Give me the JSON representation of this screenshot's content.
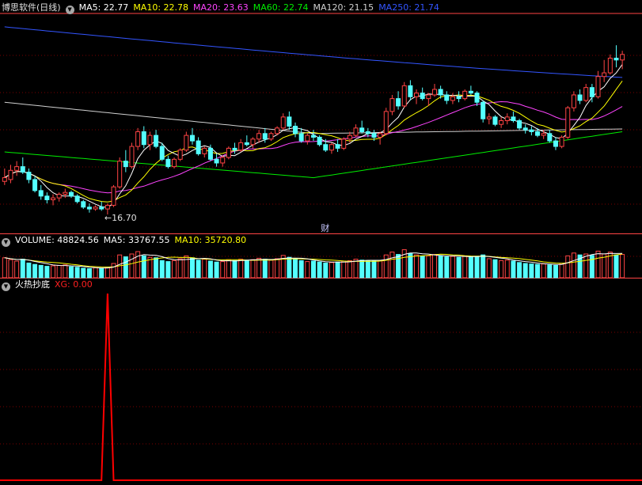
{
  "window": {
    "title": "博思软件(日线)"
  },
  "icons": {
    "dropdown": "chevron-down-icon"
  },
  "colors": {
    "background": "#000000",
    "up": "#ff4444",
    "down": "#54ffff",
    "grid": "#7a0000",
    "ma5": "#ffffff",
    "ma10": "#ffff00",
    "ma20": "#ff44ff",
    "ma60": "#00ee00",
    "ma120": "#d0d0d0",
    "ma250": "#3355ff",
    "indicator": "#ff0000"
  },
  "price_header": {
    "ma5": "MA5: 22.77",
    "ma10": "MA10: 22.78",
    "ma20": "MA20: 23.63",
    "ma60": "MA60: 22.74",
    "ma120": "MA120: 21.15",
    "ma250": "MA250: 21.74"
  },
  "volume_header": {
    "volume": "VOLUME: 48824.56",
    "ma5": "MA5: 33767.55",
    "ma10": "MA10: 35720.80"
  },
  "indicator_header": {
    "name": "火热抄底",
    "xg": "XG: 0.00"
  },
  "annotations": {
    "low_label": "←16.70",
    "finance_marker": "财"
  },
  "chart_data": [
    {
      "type": "candlestick",
      "panel": "price",
      "low_marker": 16.7,
      "ylim": [
        15.8,
        27.5
      ],
      "candles": [
        [
          18.5,
          19.2,
          18.3,
          18.7
        ],
        [
          18.6,
          19.4,
          18.4,
          19.1
        ],
        [
          19.1,
          19.6,
          18.8,
          19.3
        ],
        [
          19.3,
          19.8,
          18.9,
          19.0
        ],
        [
          19.0,
          19.2,
          18.4,
          18.6
        ],
        [
          18.6,
          18.8,
          17.9,
          18.0
        ],
        [
          18.0,
          18.3,
          17.5,
          17.7
        ],
        [
          17.7,
          17.9,
          17.3,
          17.5
        ],
        [
          17.5,
          17.8,
          17.2,
          17.6
        ],
        [
          17.6,
          17.9,
          17.4,
          17.8
        ],
        [
          17.8,
          18.1,
          17.6,
          17.9
        ],
        [
          17.9,
          18.0,
          17.6,
          17.7
        ],
        [
          17.7,
          17.8,
          17.3,
          17.4
        ],
        [
          17.4,
          17.5,
          17.0,
          17.1
        ],
        [
          17.1,
          17.3,
          16.8,
          17.0
        ],
        [
          17.0,
          17.2,
          16.9,
          17.1
        ],
        [
          17.1,
          17.4,
          16.9,
          17.0
        ],
        [
          17.0,
          17.3,
          16.7,
          17.2
        ],
        [
          17.2,
          18.3,
          17.1,
          18.2
        ],
        [
          18.2,
          19.8,
          18.1,
          19.6
        ],
        [
          19.6,
          20.2,
          19.0,
          19.3
        ],
        [
          19.3,
          20.6,
          19.2,
          20.4
        ],
        [
          20.4,
          21.4,
          20.2,
          21.2
        ],
        [
          21.2,
          21.5,
          20.3,
          20.5
        ],
        [
          20.5,
          21.2,
          20.2,
          21.0
        ],
        [
          21.0,
          21.3,
          20.3,
          20.4
        ],
        [
          20.4,
          20.6,
          19.6,
          19.7
        ],
        [
          19.7,
          19.9,
          19.2,
          19.3
        ],
        [
          19.3,
          19.8,
          19.2,
          19.7
        ],
        [
          19.7,
          20.3,
          19.6,
          20.2
        ],
        [
          20.2,
          21.2,
          20.1,
          21.0
        ],
        [
          21.0,
          21.4,
          20.5,
          20.7
        ],
        [
          20.7,
          20.9,
          19.9,
          20.0
        ],
        [
          20.0,
          20.4,
          19.8,
          20.3
        ],
        [
          20.3,
          20.5,
          19.6,
          19.7
        ],
        [
          19.7,
          20.0,
          19.3,
          19.5
        ],
        [
          19.5,
          19.9,
          19.3,
          19.8
        ],
        [
          19.8,
          20.4,
          19.7,
          20.3
        ],
        [
          20.3,
          20.6,
          20.0,
          20.2
        ],
        [
          20.2,
          20.8,
          20.1,
          20.6
        ],
        [
          20.6,
          21.0,
          20.4,
          20.5
        ],
        [
          20.5,
          20.9,
          20.3,
          20.8
        ],
        [
          20.8,
          21.3,
          20.6,
          21.1
        ],
        [
          21.1,
          21.4,
          20.6,
          20.8
        ],
        [
          20.8,
          21.2,
          20.7,
          21.1
        ],
        [
          21.1,
          21.5,
          21.0,
          21.4
        ],
        [
          21.4,
          22.2,
          21.3,
          22.0
        ],
        [
          22.0,
          22.3,
          21.3,
          21.5
        ],
        [
          21.5,
          21.7,
          20.9,
          21.1
        ],
        [
          21.1,
          21.4,
          20.6,
          20.7
        ],
        [
          20.7,
          21.1,
          20.5,
          21.0
        ],
        [
          21.0,
          21.3,
          20.7,
          20.9
        ],
        [
          20.9,
          21.0,
          20.4,
          20.5
        ],
        [
          20.5,
          20.8,
          20.1,
          20.2
        ],
        [
          20.2,
          20.6,
          20.0,
          20.5
        ],
        [
          20.5,
          20.8,
          20.1,
          20.3
        ],
        [
          20.3,
          20.9,
          20.2,
          20.8
        ],
        [
          20.8,
          21.2,
          20.6,
          21.0
        ],
        [
          21.0,
          21.6,
          20.9,
          21.4
        ],
        [
          21.4,
          21.8,
          21.1,
          21.2
        ],
        [
          21.2,
          21.4,
          20.9,
          21.1
        ],
        [
          21.1,
          21.3,
          20.7,
          20.9
        ],
        [
          20.9,
          21.2,
          20.5,
          21.1
        ],
        [
          21.1,
          22.5,
          21.0,
          22.3
        ],
        [
          22.3,
          23.2,
          22.1,
          23.0
        ],
        [
          23.0,
          23.4,
          22.4,
          22.6
        ],
        [
          22.6,
          23.9,
          22.5,
          23.7
        ],
        [
          23.7,
          24.0,
          22.9,
          23.1
        ],
        [
          23.1,
          23.5,
          22.7,
          23.3
        ],
        [
          23.3,
          23.6,
          22.9,
          23.0
        ],
        [
          23.0,
          23.3,
          22.6,
          23.2
        ],
        [
          23.2,
          23.8,
          23.1,
          23.5
        ],
        [
          23.5,
          23.7,
          23.0,
          23.2
        ],
        [
          23.2,
          23.4,
          22.7,
          22.9
        ],
        [
          22.9,
          23.3,
          22.7,
          23.1
        ],
        [
          23.1,
          23.4,
          22.8,
          23.0
        ],
        [
          23.0,
          23.5,
          22.9,
          23.4
        ],
        [
          23.4,
          23.7,
          23.2,
          23.3
        ],
        [
          23.3,
          23.4,
          22.6,
          22.8
        ],
        [
          22.8,
          22.9,
          21.7,
          21.9
        ],
        [
          21.9,
          22.2,
          21.6,
          22.0
        ],
        [
          22.0,
          22.1,
          21.5,
          21.6
        ],
        [
          21.6,
          22.0,
          21.4,
          21.8
        ],
        [
          21.8,
          22.2,
          21.6,
          22.0
        ],
        [
          22.0,
          22.3,
          21.7,
          21.8
        ],
        [
          21.8,
          21.9,
          21.3,
          21.4
        ],
        [
          21.4,
          21.6,
          21.1,
          21.3
        ],
        [
          21.3,
          21.5,
          21.0,
          21.2
        ],
        [
          21.2,
          21.4,
          20.9,
          21.0
        ],
        [
          21.0,
          21.3,
          20.8,
          21.1
        ],
        [
          21.1,
          21.3,
          20.6,
          20.7
        ],
        [
          20.7,
          20.9,
          20.2,
          20.4
        ],
        [
          20.4,
          21.0,
          20.3,
          20.9
        ],
        [
          20.9,
          22.6,
          20.8,
          22.5
        ],
        [
          22.5,
          23.4,
          22.3,
          23.2
        ],
        [
          23.2,
          23.5,
          22.7,
          22.9
        ],
        [
          22.9,
          23.8,
          22.8,
          23.6
        ],
        [
          23.6,
          23.8,
          22.8,
          23.1
        ],
        [
          23.1,
          24.5,
          23.0,
          24.2
        ],
        [
          24.2,
          25.1,
          23.9,
          24.4
        ],
        [
          24.4,
          25.4,
          24.3,
          25.2
        ],
        [
          25.2,
          25.9,
          24.7,
          25.1
        ],
        [
          25.1,
          25.6,
          24.6,
          25.4
        ]
      ]
    },
    {
      "type": "bar",
      "panel": "volume",
      "values": [
        4.2,
        3.8,
        3.5,
        3.9,
        3.1,
        2.8,
        2.6,
        2.4,
        2.5,
        2.6,
        2.7,
        2.3,
        2.2,
        2.0,
        1.9,
        2.1,
        2.0,
        2.2,
        3.0,
        4.8,
        4.4,
        5.0,
        5.5,
        4.6,
        4.3,
        4.2,
        3.6,
        3.4,
        3.6,
        4.0,
        4.6,
        4.2,
        3.7,
        3.9,
        3.5,
        3.3,
        3.4,
        3.8,
        3.6,
        3.9,
        3.7,
        3.8,
        4.1,
        3.9,
        3.7,
        4.0,
        4.7,
        4.3,
        3.9,
        3.6,
        3.4,
        3.5,
        3.3,
        3.1,
        3.2,
        3.3,
        3.5,
        3.6,
        3.9,
        3.7,
        3.6,
        3.5,
        3.6,
        4.8,
        5.4,
        4.9,
        5.9,
        5.1,
        4.8,
        4.5,
        4.6,
        4.9,
        4.6,
        4.4,
        4.5,
        4.3,
        4.6,
        4.4,
        4.5,
        4.8,
        4.0,
        3.8,
        3.6,
        3.7,
        3.5,
        3.2,
        3.0,
        2.9,
        2.8,
        2.9,
        2.7,
        2.6,
        3.0,
        4.6,
        5.2,
        4.8,
        5.0,
        4.7,
        5.6,
        5.0,
        5.4,
        4.8,
        4.9
      ]
    },
    {
      "type": "line",
      "panel": "indicator",
      "name": "XG",
      "ylim": [
        0,
        1
      ],
      "values": [
        0,
        0,
        0,
        0,
        0,
        0,
        0,
        0,
        0,
        0,
        0,
        0,
        0,
        0,
        0,
        0,
        0,
        1,
        0,
        0,
        0,
        0,
        0,
        0,
        0,
        0,
        0,
        0,
        0,
        0,
        0,
        0,
        0,
        0,
        0,
        0,
        0,
        0,
        0,
        0,
        0,
        0,
        0,
        0,
        0,
        0,
        0,
        0,
        0,
        0,
        0,
        0,
        0,
        0,
        0,
        0,
        0,
        0,
        0,
        0,
        0,
        0,
        0,
        0,
        0,
        0,
        0,
        0,
        0,
        0,
        0,
        0,
        0,
        0,
        0,
        0,
        0,
        0,
        0,
        0,
        0,
        0,
        0,
        0,
        0,
        0,
        0,
        0,
        0,
        0,
        0,
        0,
        0,
        0,
        0,
        0,
        0,
        0,
        0,
        0,
        0,
        0,
        0
      ]
    }
  ]
}
